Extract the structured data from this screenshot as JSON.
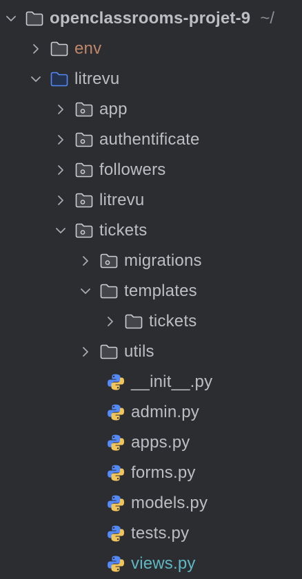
{
  "project_tree": {
    "colors": {
      "default_text": "#bcbec4",
      "excluded": "#c0876a",
      "modified": "#5fb7c2",
      "source_root": "#548af7"
    },
    "items": [
      {
        "label": "openclassrooms-projet-9",
        "hint": "~/",
        "level": 0,
        "type": "folder",
        "state": "expanded",
        "bold": true
      },
      {
        "label": "env",
        "level": 1,
        "type": "folder",
        "state": "collapsed",
        "color": "excluded"
      },
      {
        "label": "litrevu",
        "level": 1,
        "type": "source-root-folder",
        "state": "expanded"
      },
      {
        "label": "app",
        "level": 2,
        "type": "package-folder",
        "state": "collapsed"
      },
      {
        "label": "authentificate",
        "level": 2,
        "type": "package-folder",
        "state": "collapsed"
      },
      {
        "label": "followers",
        "level": 2,
        "type": "package-folder",
        "state": "collapsed"
      },
      {
        "label": "litrevu",
        "level": 2,
        "type": "package-folder",
        "state": "collapsed"
      },
      {
        "label": "tickets",
        "level": 2,
        "type": "package-folder",
        "state": "expanded"
      },
      {
        "label": "migrations",
        "level": 3,
        "type": "package-folder",
        "state": "collapsed"
      },
      {
        "label": "templates",
        "level": 3,
        "type": "folder",
        "state": "expanded"
      },
      {
        "label": "tickets",
        "level": 4,
        "type": "folder",
        "state": "collapsed"
      },
      {
        "label": "utils",
        "level": 3,
        "type": "folder",
        "state": "collapsed"
      },
      {
        "label": "__init__.py",
        "level": 3,
        "type": "python-file"
      },
      {
        "label": "admin.py",
        "level": 3,
        "type": "python-file"
      },
      {
        "label": "apps.py",
        "level": 3,
        "type": "python-file"
      },
      {
        "label": "forms.py",
        "level": 3,
        "type": "python-file"
      },
      {
        "label": "models.py",
        "level": 3,
        "type": "python-file"
      },
      {
        "label": "tests.py",
        "level": 3,
        "type": "python-file"
      },
      {
        "label": "views.py",
        "level": 3,
        "type": "python-file",
        "color": "modified"
      }
    ]
  }
}
